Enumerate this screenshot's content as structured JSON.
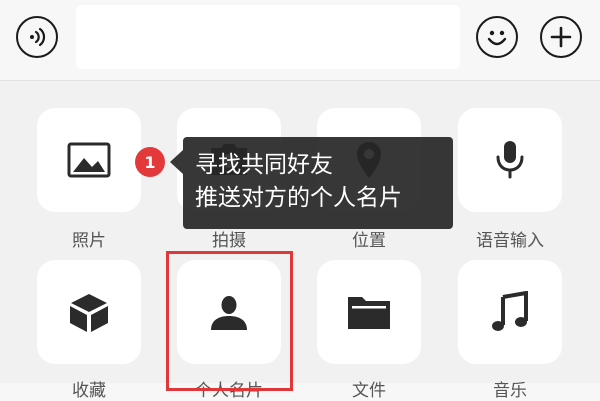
{
  "icons": {
    "voice_toggle": "voice-wave-icon",
    "emoji": "smiley-icon",
    "more": "plus-icon"
  },
  "panel_items": [
    {
      "icon": "image-icon",
      "label": "照片"
    },
    {
      "icon": "camera-icon",
      "label": "拍摄"
    },
    {
      "icon": "location-pin-icon",
      "label": "位置"
    },
    {
      "icon": "microphone-icon",
      "label": "语音输入"
    },
    {
      "icon": "cube-icon",
      "label": "收藏"
    },
    {
      "icon": "person-icon",
      "label": "个人名片"
    },
    {
      "icon": "folder-icon",
      "label": "文件"
    },
    {
      "icon": "music-note-icon",
      "label": "音乐"
    }
  ],
  "annotation": {
    "step_badge": "1",
    "tooltip_line1": "寻找共同好友",
    "tooltip_line2": "推送对方的个人名片",
    "highlight_color": "#e0383a"
  },
  "colors": {
    "topbar_bg": "#f7f7f7",
    "panel_bg": "#f1f1f1",
    "tile_bg": "#ffffff",
    "icon": "#2b2b2b",
    "badge": "#e3393a"
  }
}
